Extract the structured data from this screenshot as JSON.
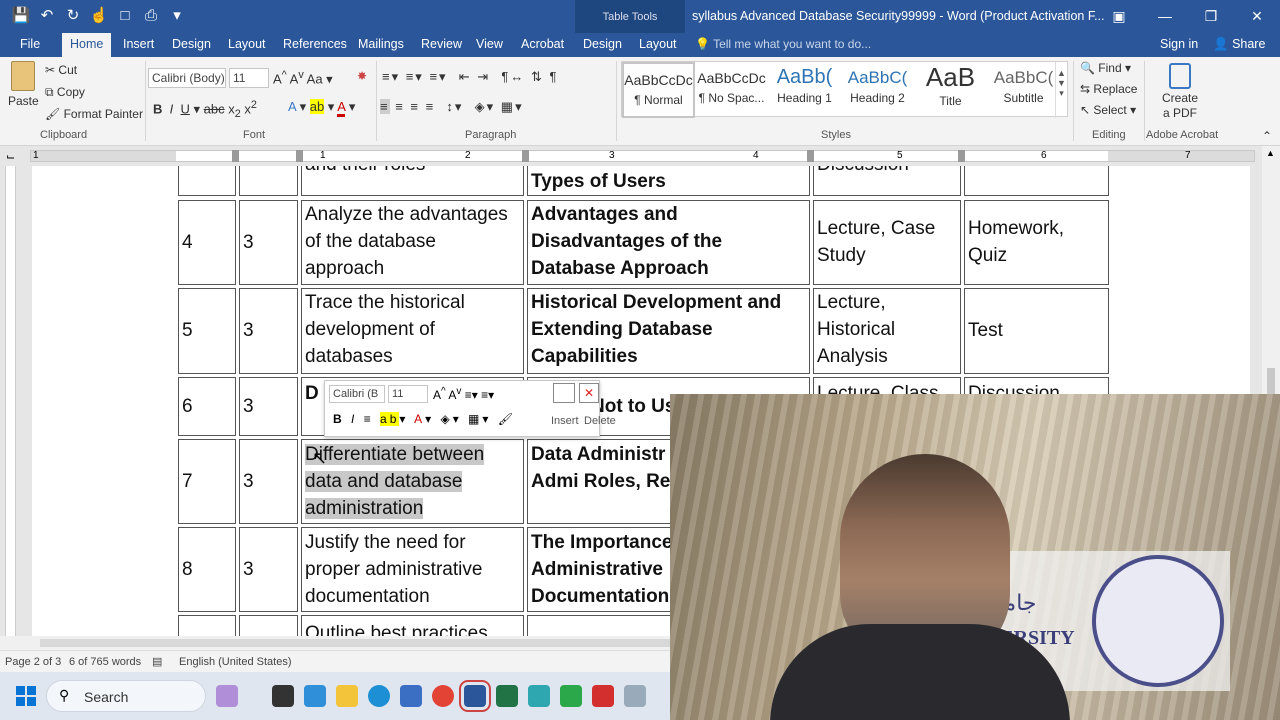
{
  "titlebar": {
    "context_tab": "Table Tools",
    "doc_title": "syllabus Advanced Database Security99999 - Word (Product Activation F..."
  },
  "menu": {
    "tabs": [
      "File",
      "Home",
      "Insert",
      "Design",
      "Layout",
      "References",
      "Mailings",
      "Review",
      "View",
      "Acrobat",
      "Design",
      "Layout"
    ],
    "active": "Home",
    "tell_me": "Tell me what you want to do...",
    "sign_in": "Sign in",
    "share": "Share"
  },
  "ribbon": {
    "clipboard": {
      "paste": "Paste",
      "cut": "Cut",
      "copy": "Copy",
      "format_painter": "Format Painter",
      "label": "Clipboard"
    },
    "font": {
      "name": "Calibri (Body)",
      "size": "11",
      "label": "Font"
    },
    "paragraph": {
      "label": "Paragraph"
    },
    "styles": {
      "items": [
        {
          "preview": "AaBbCcDc",
          "name": "¶ Normal"
        },
        {
          "preview": "AaBbCcDc",
          "name": "¶ No Spac..."
        },
        {
          "preview": "AaBb(",
          "name": "Heading 1"
        },
        {
          "preview": "AaBbC(",
          "name": "Heading 2"
        },
        {
          "preview": "AaB",
          "name": "Title"
        },
        {
          "preview": "AaBbC(",
          "name": "Subtitle"
        }
      ],
      "label": "Styles"
    },
    "editing": {
      "find": "Find",
      "replace": "Replace",
      "select": "Select",
      "label": "Editing"
    },
    "acrobat": {
      "create": "Create a PDF",
      "label": "Adobe Acrobat"
    }
  },
  "ruler": {
    "numbers": [
      "1",
      "1",
      "2",
      "3",
      "4",
      "5",
      "6",
      "7"
    ]
  },
  "table": {
    "rows": [
      {
        "week": "",
        "hours": "",
        "outcome": "and their roles",
        "topic": "Types of Users",
        "method": "Discussion",
        "assessment": ""
      },
      {
        "week": "4",
        "hours": "3",
        "outcome": "Analyze the advantages of the database approach",
        "topic": "Advantages and Disadvantages of the Database Approach",
        "method": "Lecture, Case Study",
        "assessment": "Homework, Quiz"
      },
      {
        "week": "5",
        "hours": "3",
        "outcome": "Trace the historical development of databases",
        "topic": "Historical Development and Extending Database Capabilities",
        "method": "Lecture, Historical Analysis",
        "assessment": "Test"
      },
      {
        "week": "6",
        "hours": "3",
        "outcome": "D",
        "topic": "Not to Us",
        "method": "Lecture, Class",
        "assessment": "Discussion"
      },
      {
        "week": "7",
        "hours": "3",
        "outcome": "Differentiate between data and database administration",
        "topic": "Data Administr Database Admi Roles, Responsi",
        "method": "",
        "assessment": ""
      },
      {
        "week": "8",
        "hours": "3",
        "outcome": "Justify the need for proper administrative documentation",
        "topic": "The Importance Administrative Documentation",
        "method": "",
        "assessment": ""
      },
      {
        "week": "",
        "hours": "",
        "outcome": "Outline best practices",
        "topic": "",
        "method": "",
        "assessment": ""
      }
    ]
  },
  "minibar": {
    "font": "Calibri (B",
    "size": "11",
    "insert": "Insert",
    "delete": "Delete"
  },
  "status": {
    "page": "Page 2 of 3",
    "words": "6 of 765 words",
    "language": "English (United States)"
  },
  "taskbar": {
    "search": "Search"
  },
  "webcam": {
    "logo_text": "IVERSITY",
    "logo_arabic": "جامعة"
  }
}
